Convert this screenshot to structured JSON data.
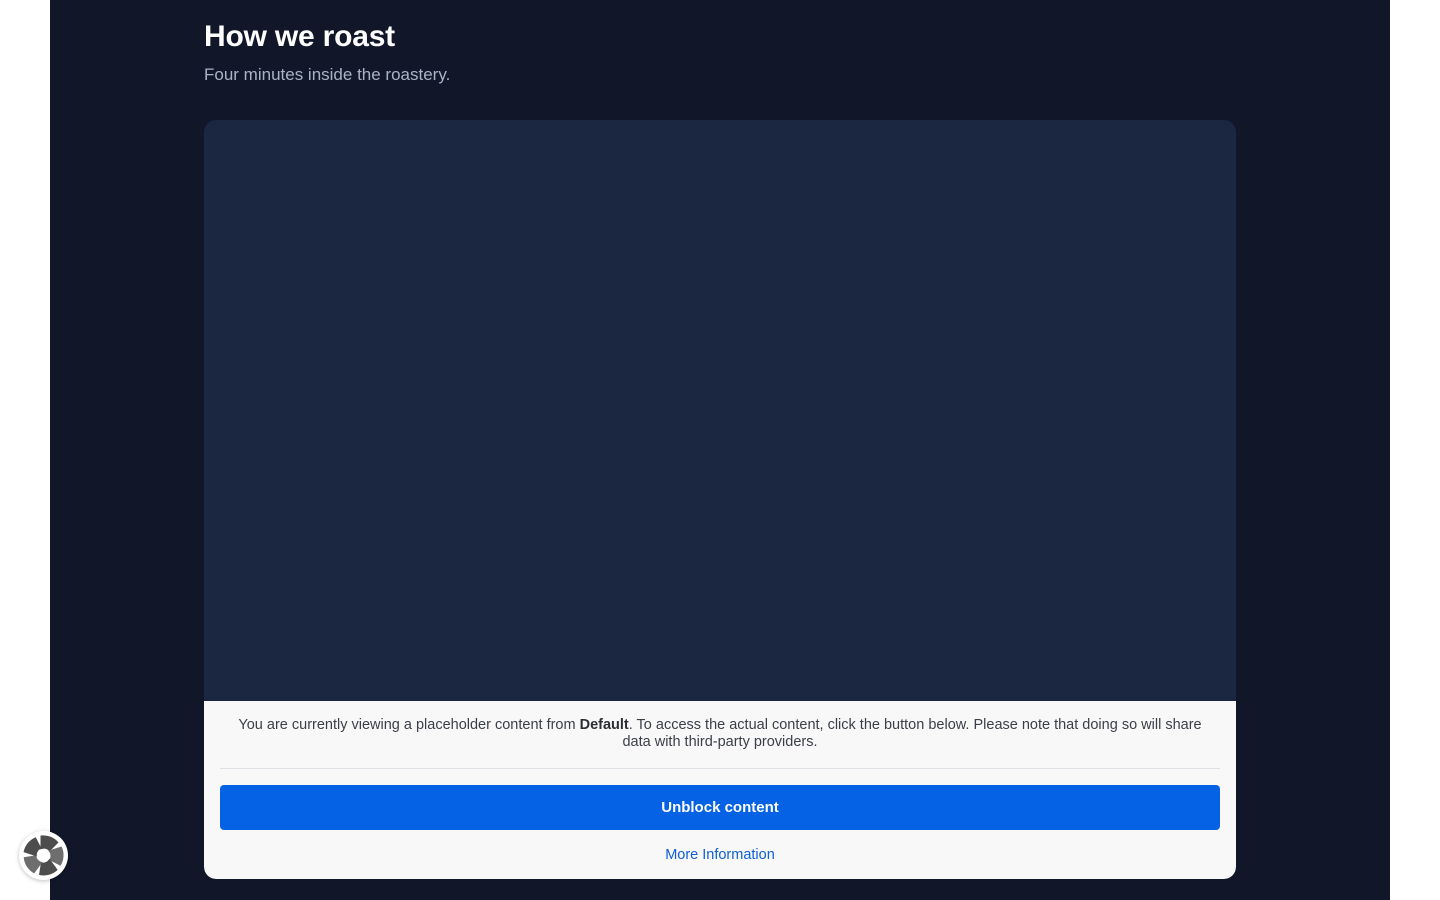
{
  "header": {
    "title": "How we roast",
    "subtitle": "Four minutes inside the roastery."
  },
  "consent": {
    "notice_prefix": "You are currently viewing a placeholder content from ",
    "provider": "Default",
    "notice_suffix": ". To access the actual content, click the button below. Please note that doing so will share data with third-party providers.",
    "unblock_label": "Unblock content",
    "more_info_label": "More Information"
  },
  "floating_button": {
    "icon": "privacy-settings-icon"
  },
  "colors": {
    "page_background": "#111729",
    "embed_background": "#1b2641",
    "button": "#0562e4",
    "link": "#0f5fd8"
  }
}
